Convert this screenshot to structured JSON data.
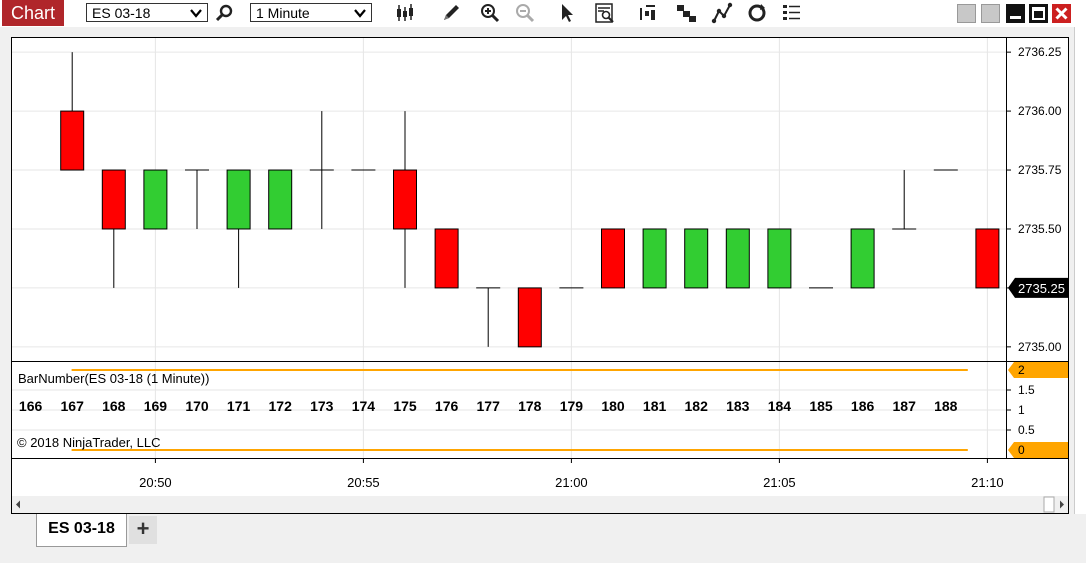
{
  "toolbar": {
    "title": "Chart",
    "instrument": "ES 03-18",
    "interval": "1 Minute",
    "icons": [
      "search-icon",
      "bars-type-icon",
      "draw-pencil-icon",
      "zoom-in-icon",
      "zoom-out-icon",
      "pointer-icon",
      "data-box-icon",
      "strategy-icon",
      "indicators-icon",
      "drawing-tools-icon",
      "refresh-icon",
      "properties-list-icon"
    ]
  },
  "tab": {
    "label": "ES 03-18",
    "add_label": "+"
  },
  "colors": {
    "up": "#32cd32",
    "down": "#ff0000",
    "accent": "#ffa500",
    "current_price_bg": "#000000"
  },
  "chart_data": {
    "type": "candlestick",
    "instrument": "ES 03-18",
    "interval": "1 Minute",
    "price_axis": {
      "ylim": [
        2734.94,
        2736.31
      ],
      "ticks": [
        2735.0,
        2735.25,
        2735.5,
        2735.75,
        2736.0,
        2736.25
      ],
      "tick_labels": [
        "2735.00",
        "2735.25",
        "2735.50",
        "2735.75",
        "2736.00",
        "2736.25"
      ]
    },
    "current_price": "2735.25",
    "time_axis": {
      "labels": [
        "20:50",
        "20:55",
        "21:00",
        "21:05",
        "21:10"
      ],
      "label_bars": [
        169,
        174,
        179,
        184,
        189
      ]
    },
    "bars": [
      {
        "n": 167,
        "o": 2736.0,
        "h": 2736.25,
        "l": 2735.75,
        "c": 2735.75
      },
      {
        "n": 168,
        "o": 2735.75,
        "h": 2735.75,
        "l": 2735.25,
        "c": 2735.5
      },
      {
        "n": 169,
        "o": 2735.5,
        "h": 2735.75,
        "l": 2735.5,
        "c": 2735.75
      },
      {
        "n": 170,
        "o": 2735.75,
        "h": 2735.75,
        "l": 2735.5,
        "c": 2735.75
      },
      {
        "n": 171,
        "o": 2735.5,
        "h": 2735.75,
        "l": 2735.25,
        "c": 2735.75
      },
      {
        "n": 172,
        "o": 2735.5,
        "h": 2735.75,
        "l": 2735.5,
        "c": 2735.75
      },
      {
        "n": 173,
        "o": 2735.75,
        "h": 2736.0,
        "l": 2735.5,
        "c": 2735.75
      },
      {
        "n": 174,
        "o": 2735.75,
        "h": 2735.75,
        "l": 2735.75,
        "c": 2735.75
      },
      {
        "n": 175,
        "o": 2735.75,
        "h": 2736.0,
        "l": 2735.25,
        "c": 2735.5
      },
      {
        "n": 176,
        "o": 2735.5,
        "h": 2735.5,
        "l": 2735.25,
        "c": 2735.25
      },
      {
        "n": 177,
        "o": 2735.25,
        "h": 2735.25,
        "l": 2735.0,
        "c": 2735.25
      },
      {
        "n": 178,
        "o": 2735.25,
        "h": 2735.25,
        "l": 2735.0,
        "c": 2735.0
      },
      {
        "n": 179,
        "o": 2735.25,
        "h": 2735.25,
        "l": 2735.25,
        "c": 2735.25
      },
      {
        "n": 180,
        "o": 2735.5,
        "h": 2735.5,
        "l": 2735.25,
        "c": 2735.25
      },
      {
        "n": 181,
        "o": 2735.25,
        "h": 2735.5,
        "l": 2735.25,
        "c": 2735.5
      },
      {
        "n": 182,
        "o": 2735.25,
        "h": 2735.5,
        "l": 2735.25,
        "c": 2735.5
      },
      {
        "n": 183,
        "o": 2735.25,
        "h": 2735.5,
        "l": 2735.25,
        "c": 2735.5
      },
      {
        "n": 184,
        "o": 2735.25,
        "h": 2735.5,
        "l": 2735.25,
        "c": 2735.5
      },
      {
        "n": 185,
        "o": 2735.25,
        "h": 2735.25,
        "l": 2735.25,
        "c": 2735.25
      },
      {
        "n": 186,
        "o": 2735.25,
        "h": 2735.5,
        "l": 2735.25,
        "c": 2735.5
      },
      {
        "n": 187,
        "o": 2735.5,
        "h": 2735.75,
        "l": 2735.5,
        "c": 2735.5
      },
      {
        "n": 188,
        "o": 2735.75,
        "h": 2735.75,
        "l": 2735.75,
        "c": 2735.75
      },
      {
        "n": 189,
        "o": 2735.5,
        "h": 2735.5,
        "l": 2735.25,
        "c": 2735.25
      }
    ],
    "indicator": {
      "label": "BarNumber(ES 03-18 (1 Minute))",
      "copyright": "© 2018 NinjaTrader, LLC",
      "ylim": [
        -0.2,
        2.2
      ],
      "ticks": [
        0.5,
        1,
        1.5
      ],
      "tick_labels": [
        "0.5",
        "1",
        "1.5"
      ],
      "level_high": "2",
      "level_low": "0",
      "numbers": [
        "166",
        "167",
        "168",
        "169",
        "170",
        "171",
        "172",
        "173",
        "174",
        "175",
        "176",
        "177",
        "178",
        "179",
        "180",
        "181",
        "182",
        "183",
        "184",
        "185",
        "186",
        "187",
        "188"
      ],
      "number_bars": [
        166,
        167,
        168,
        169,
        170,
        171,
        172,
        173,
        174,
        175,
        176,
        177,
        178,
        179,
        180,
        181,
        182,
        183,
        184,
        185,
        186,
        187,
        188
      ]
    }
  }
}
